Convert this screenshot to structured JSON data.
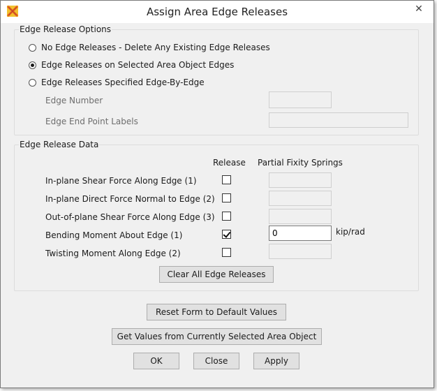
{
  "window": {
    "title": "Assign Area Edge Releases",
    "close_glyph": "✕",
    "icon": "sap-app-icon"
  },
  "options_group": {
    "legend": "Edge Release Options",
    "radios": [
      {
        "label": "No Edge Releases - Delete Any Existing Edge Releases",
        "selected": false
      },
      {
        "label": "Edge Releases on Selected Area Object Edges",
        "selected": true
      },
      {
        "label": "Edge Releases Specified Edge-By-Edge",
        "selected": false
      }
    ],
    "edge_number_label": "Edge Number",
    "edge_number_value": "",
    "end_point_label": "Edge End Point Labels",
    "end_point_value": ""
  },
  "data_group": {
    "legend": "Edge Release Data",
    "col_release": "Release",
    "col_springs": "Partial Fixity Springs",
    "rows": [
      {
        "label": "In-plane Shear Force Along Edge (1)",
        "checked": false,
        "value": "",
        "unit": ""
      },
      {
        "label": "In-plane Direct Force Normal to Edge (2)",
        "checked": false,
        "value": "",
        "unit": ""
      },
      {
        "label": "Out-of-plane Shear Force Along Edge (3)",
        "checked": false,
        "value": "",
        "unit": ""
      },
      {
        "label": "Bending Moment About Edge (1)",
        "checked": true,
        "value": "0",
        "unit": "kip/rad"
      },
      {
        "label": "Twisting Moment Along Edge (2)",
        "checked": false,
        "value": "",
        "unit": ""
      }
    ],
    "clear_label": "Clear All Edge Releases"
  },
  "buttons": {
    "reset": "Reset Form to Default Values",
    "get_values": "Get Values from Currently Selected Area Object",
    "ok": "OK",
    "close": "Close",
    "apply": "Apply"
  },
  "colors": {
    "icon_orange": "#e8741c",
    "icon_yellow": "#f2c12e",
    "window_bg": "#f0f0f0"
  }
}
